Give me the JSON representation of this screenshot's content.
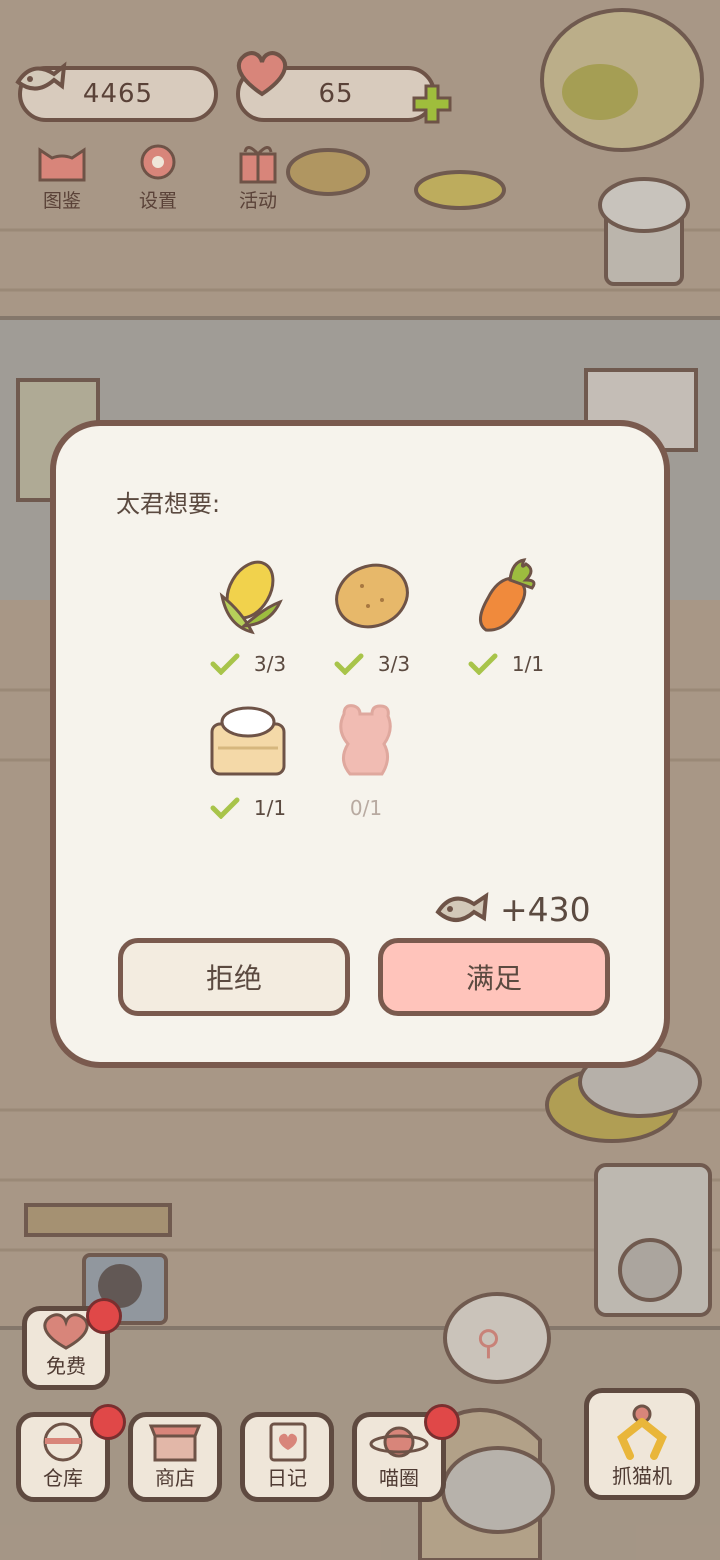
{
  "top_bar": {
    "fish_currency": "4465",
    "heart_currency": "65"
  },
  "top_menu": [
    {
      "label": "图鉴"
    },
    {
      "label": "设置"
    },
    {
      "label": "活动"
    }
  ],
  "dialog": {
    "prompt": "太君想要:",
    "items": [
      {
        "name": "corn",
        "count": "3/3",
        "done": true
      },
      {
        "name": "potato",
        "count": "3/3",
        "done": true
      },
      {
        "name": "carrot",
        "count": "1/1",
        "done": true
      },
      {
        "name": "flour",
        "count": "1/1",
        "done": true
      },
      {
        "name": "gummy-bear",
        "count": "0/1",
        "done": false
      }
    ],
    "reward": "+430",
    "reject_label": "拒绝",
    "accept_label": "满足"
  },
  "bottom_bar": {
    "free_label": "免费",
    "warehouse_label": "仓库",
    "shop_label": "商店",
    "diary_label": "日记",
    "meow_circle_label": "喵圈",
    "claw_machine_label": "抓猫机"
  },
  "colors": {
    "accept": "#ffc4bb",
    "reject": "#f3ece0",
    "check": "#a8c44a",
    "border": "#7a5a4e"
  }
}
